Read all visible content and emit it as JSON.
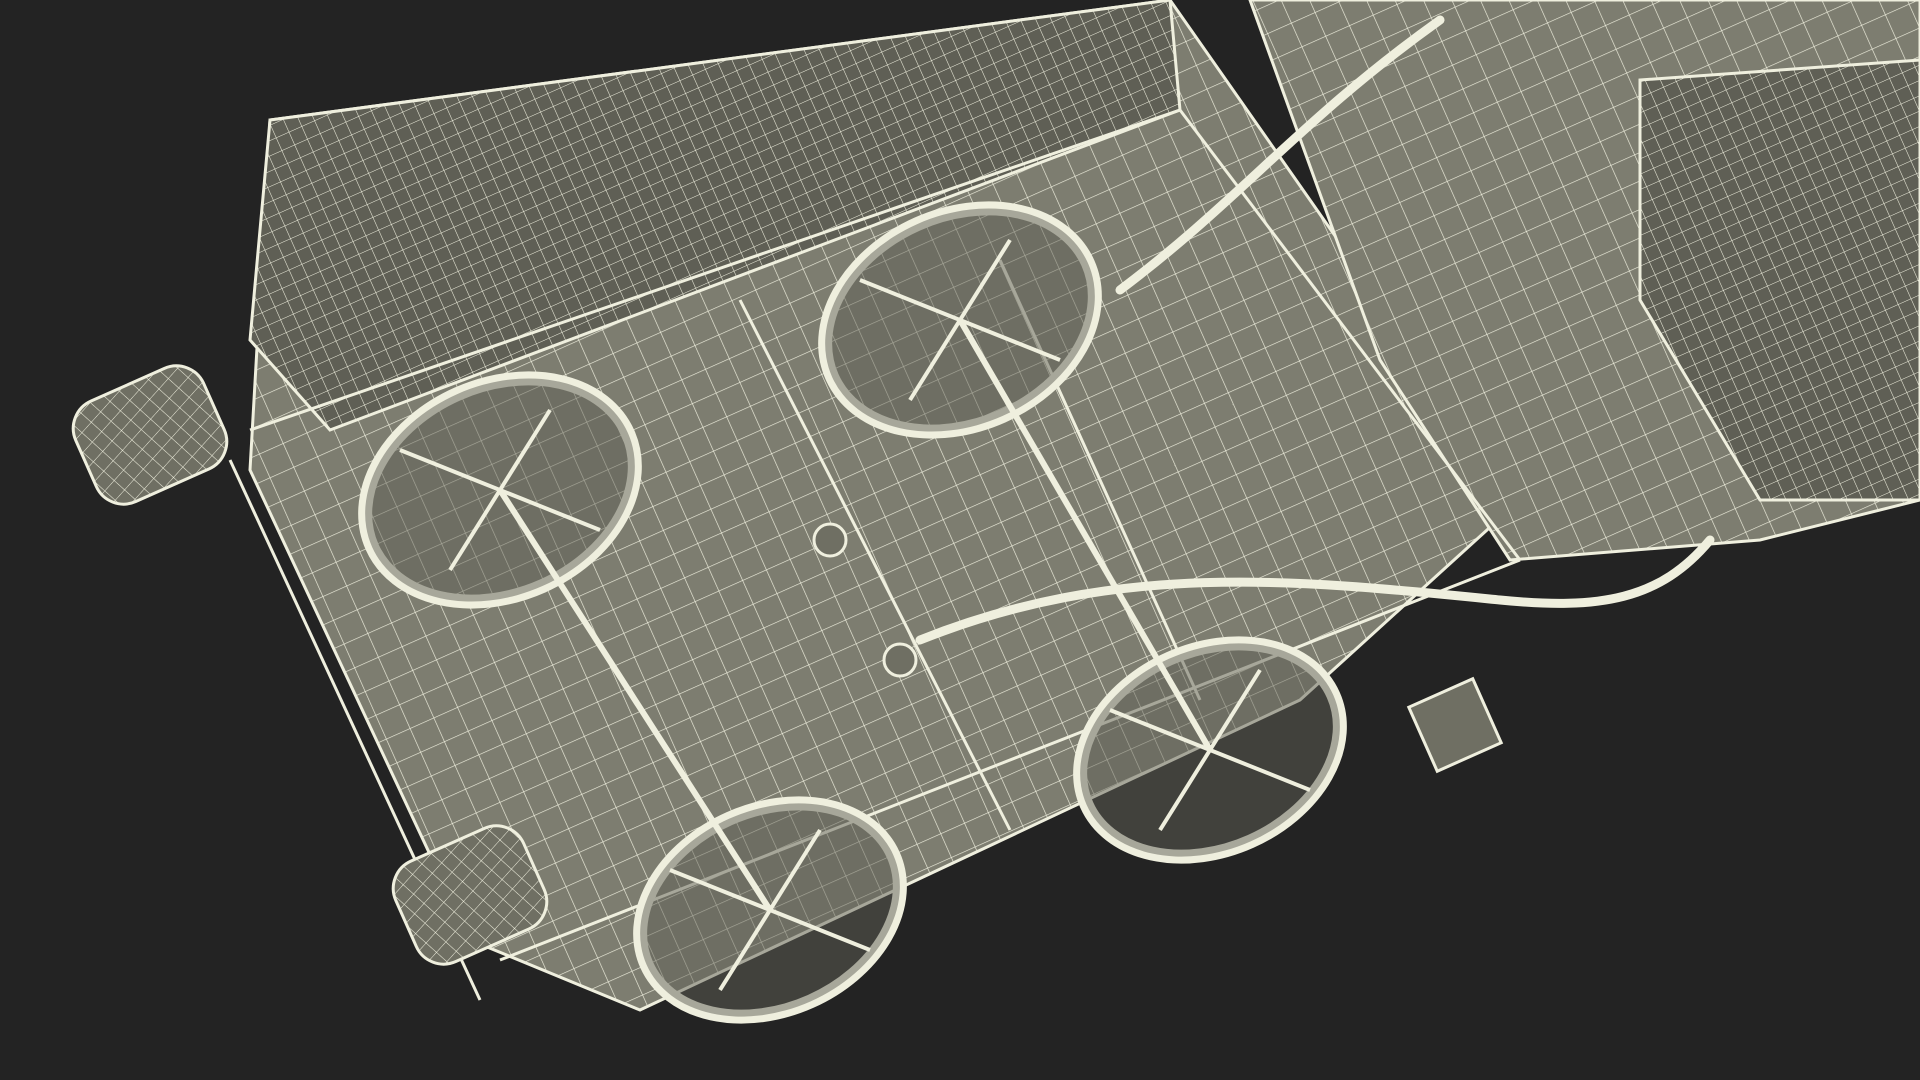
{
  "scene": {
    "background_color": "#232323",
    "mesh_fill_color": "#7d7d70",
    "mesh_shade_color": "#5f5f55",
    "wire_color": "#efefde"
  }
}
